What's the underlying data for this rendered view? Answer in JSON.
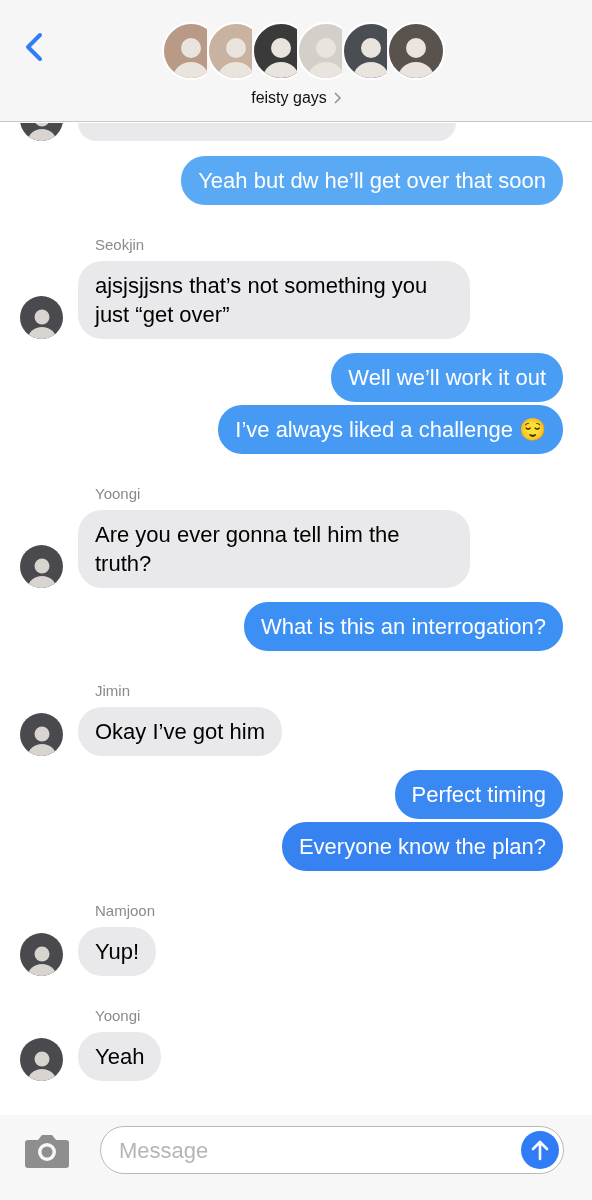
{
  "header": {
    "title": "feisty gays"
  },
  "messages": [
    {
      "kind": "cut_in"
    },
    {
      "kind": "out",
      "text": "Yeah but dw he’ll get over that soon"
    },
    {
      "kind": "in",
      "sender": "Seokjin",
      "text": "ajsjsjjsns that’s not something you just “get over”"
    },
    {
      "kind": "out",
      "text": "Well we’ll work it out"
    },
    {
      "kind": "out",
      "text": "I’ve always liked a challenge 😌"
    },
    {
      "kind": "in",
      "sender": "Yoongi",
      "text": "Are you ever gonna tell him the truth?"
    },
    {
      "kind": "out",
      "text": "What is this an interrogation?"
    },
    {
      "kind": "in",
      "sender": "Jimin",
      "text": "Okay I’ve got him"
    },
    {
      "kind": "out",
      "text": "Perfect timing"
    },
    {
      "kind": "out",
      "text": "Everyone know the plan?"
    },
    {
      "kind": "in",
      "sender": "Namjoon",
      "text": "Yup!"
    },
    {
      "kind": "in",
      "sender": "Yoongi",
      "text": "Yeah"
    }
  ],
  "composer": {
    "placeholder": "Message"
  }
}
